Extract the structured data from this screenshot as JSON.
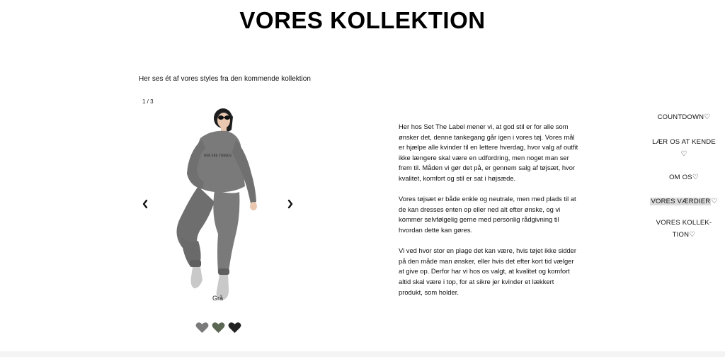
{
  "page": {
    "title": "VORES KOLLEKTION",
    "intro": "Her ses ét af vores styles fra den kommende kollektion"
  },
  "carousel": {
    "counter": "1 / 3",
    "prev_label": "‹",
    "next_label": "›",
    "caption": "Grå",
    "image_print_text": "HER ERE TOKEEV",
    "swatches": [
      {
        "name": "grey",
        "color": "#7b7b7b"
      },
      {
        "name": "olive",
        "color": "#5b6655"
      },
      {
        "name": "black",
        "color": "#222222"
      }
    ]
  },
  "text": {
    "p1": "Her hos Set The Label mener vi, at god stil er for alle som ønsker det, denne tankegang går igen i vores tøj. Vores mål er hjælpe alle kvinder til en lettere hverdag, hvor valg af outfit ikke længere skal være en udfordring, men noget man ser frem til. Måden vi gør det på, er gennem salg af tøjsæt, hvor kvalitet, komfort og stil er sat i højsæde.",
    "p2": "Vores tøjsæt er både enkle og neutrale, men med plads til at de kan dresses enten op eller ned alt efter ønske, og vi kommer selvfølgelig gerne med personlig rådgivning til hvordan dette kan gøres.",
    "p3": "Vi ved hvor stor en plage det kan være, hvis tøjet ikke sidder på den måde man ønsker, eller hvis det efter kort tid vælger at give op. Derfor har vi hos os valgt, at kvalitet og komfort altid skal være i top, for at sikre jer kvinder et lækkert produkt, som holder."
  },
  "nav": {
    "heart": "♡",
    "items": [
      {
        "line1": "COUNTDOWN",
        "line2": ""
      },
      {
        "line1": "LÆR OS AT KENDE",
        "line2": ""
      },
      {
        "line1": "OM OS",
        "line2": ""
      },
      {
        "line1": "VORES VÆRDIER",
        "line2": ""
      },
      {
        "line1": "VORES KOLLEK-",
        "line2": "TION"
      }
    ]
  },
  "colors": {
    "outfit": "#7a7a7a",
    "outfit_dark": "#646464",
    "skin": "#e9c7b0",
    "hair": "#1e1e1e",
    "sock": "#c9c9c9",
    "active_highlight": "#dcdcdc"
  }
}
